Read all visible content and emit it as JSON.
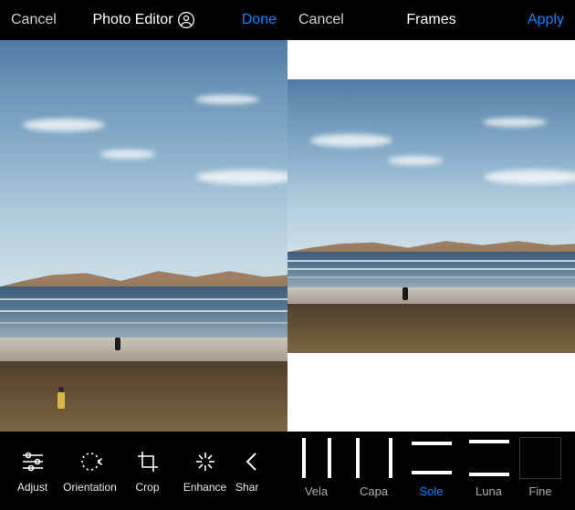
{
  "left": {
    "cancel": "Cancel",
    "title": "Photo Editor",
    "done": "Done",
    "tools": [
      {
        "label": "Adjust"
      },
      {
        "label": "Orientation"
      },
      {
        "label": "Crop"
      },
      {
        "label": "Enhance"
      },
      {
        "label": "Shar"
      }
    ]
  },
  "right": {
    "cancel": "Cancel",
    "title": "Frames",
    "apply": "Apply",
    "frames": [
      {
        "label": "Vela",
        "selected": false
      },
      {
        "label": "Capa",
        "selected": false
      },
      {
        "label": "Sole",
        "selected": true
      },
      {
        "label": "Luna",
        "selected": false
      },
      {
        "label": "Fine",
        "selected": false
      }
    ]
  },
  "colors": {
    "accent": "#0a84ff"
  }
}
